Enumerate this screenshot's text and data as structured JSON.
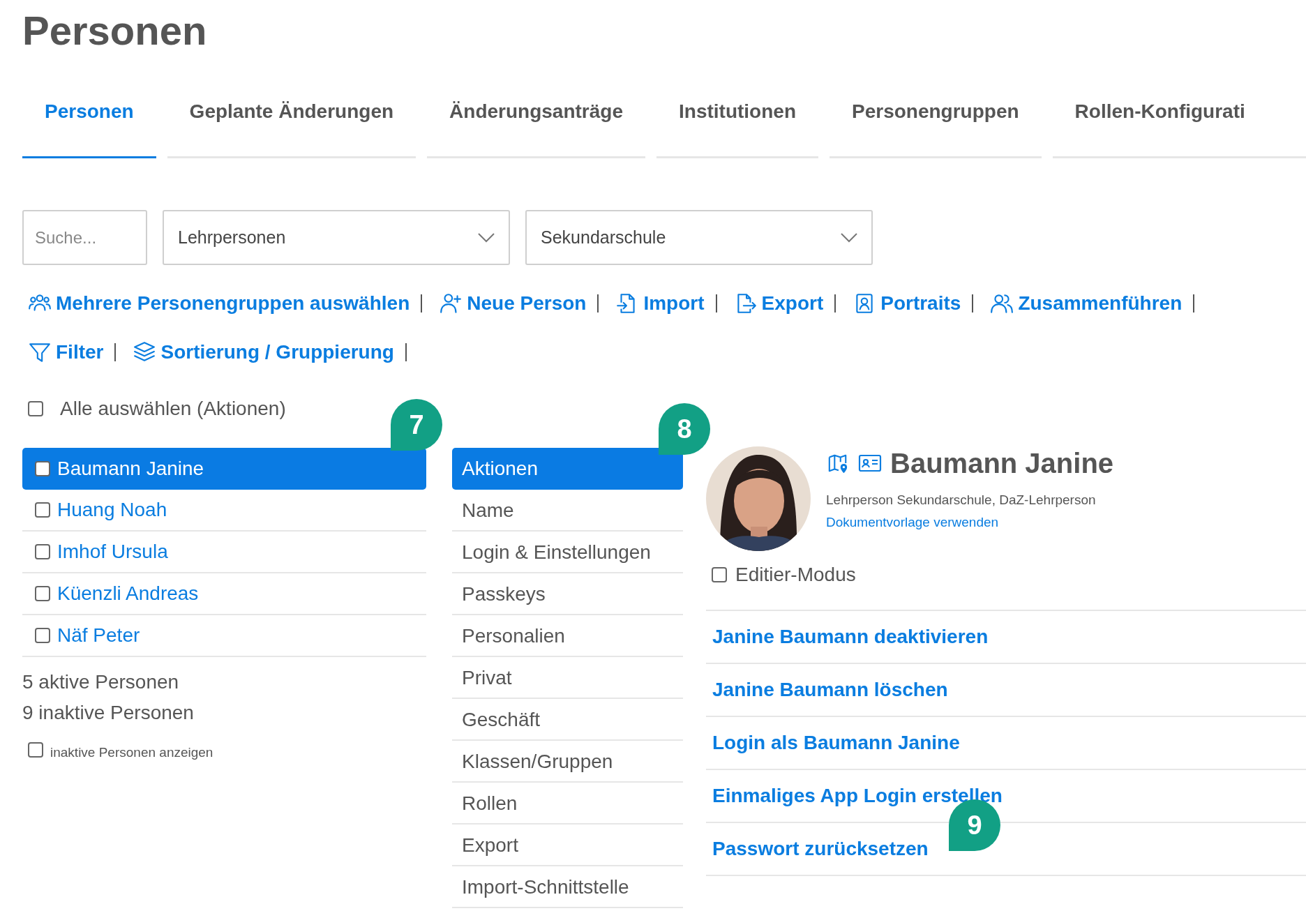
{
  "title": "Personen",
  "tabs": [
    {
      "label": "Personen",
      "selected": true
    },
    {
      "label": "Geplante Änderungen",
      "selected": false
    },
    {
      "label": "Änderungsanträge",
      "selected": false
    },
    {
      "label": "Institutionen",
      "selected": false
    },
    {
      "label": "Personengruppen",
      "selected": false
    },
    {
      "label": "Rollen-Konfigurati",
      "selected": false
    }
  ],
  "search": {
    "placeholder": "Suche..."
  },
  "filters": [
    {
      "value": "Lehrpersonen"
    },
    {
      "value": "Sekundarschule"
    }
  ],
  "toolbar_rows": [
    [
      {
        "label": "Mehrere Personengruppen auswählen",
        "kind": "group"
      },
      {
        "label": "Neue Person",
        "kind": "add"
      },
      {
        "label": "Import",
        "kind": "import"
      },
      {
        "label": "Export",
        "kind": "export"
      },
      {
        "label": "Portraits",
        "kind": "portrait"
      },
      {
        "label": "Zusammenführen",
        "kind": "merge"
      }
    ],
    [
      {
        "label": "Filter",
        "kind": "filter"
      },
      {
        "label": "Sortierung / Gruppierung",
        "kind": "sort"
      }
    ]
  ],
  "select_all": {
    "label": "Alle auswählen (Aktionen)",
    "checked": false
  },
  "persons": [
    {
      "name": "Baumann Janine",
      "selected": true,
      "checked": false
    },
    {
      "name": "Huang Noah",
      "selected": false,
      "checked": false
    },
    {
      "name": "Imhof Ursula",
      "selected": false,
      "checked": false
    },
    {
      "name": "Küenzli Andreas",
      "selected": false,
      "checked": false
    },
    {
      "name": "Näf Peter",
      "selected": false,
      "checked": false
    }
  ],
  "counts": [
    "5 aktive Personen",
    "9 inaktive Personen"
  ],
  "show_inactive": {
    "label": "inaktive Personen anzeigen",
    "checked": false
  },
  "sections": [
    {
      "label": "Aktionen",
      "selected": true
    },
    {
      "label": "Name",
      "selected": false
    },
    {
      "label": "Login & Einstellungen",
      "selected": false
    },
    {
      "label": "Passkeys",
      "selected": false
    },
    {
      "label": "Personalien",
      "selected": false
    },
    {
      "label": "Privat",
      "selected": false
    },
    {
      "label": "Geschäft",
      "selected": false
    },
    {
      "label": "Klassen/Gruppen",
      "selected": false
    },
    {
      "label": "Rollen",
      "selected": false
    },
    {
      "label": "Export",
      "selected": false
    },
    {
      "label": "Import-Schnittstelle",
      "selected": false
    }
  ],
  "profile": {
    "name": "Baumann Janine",
    "subtitle": "Lehrperson Sekundarschule, DaZ-Lehrperson",
    "link": "Dokumentvorlage verwenden"
  },
  "edit_mode": {
    "label": "Editier-Modus",
    "checked": false
  },
  "actions": [
    "Janine Baumann deaktivieren",
    "Janine Baumann löschen",
    "Login als Baumann Janine",
    "Einmaliges App Login erstellen",
    "Passwort zurücksetzen"
  ],
  "markers": [
    "7",
    "8",
    "9"
  ]
}
